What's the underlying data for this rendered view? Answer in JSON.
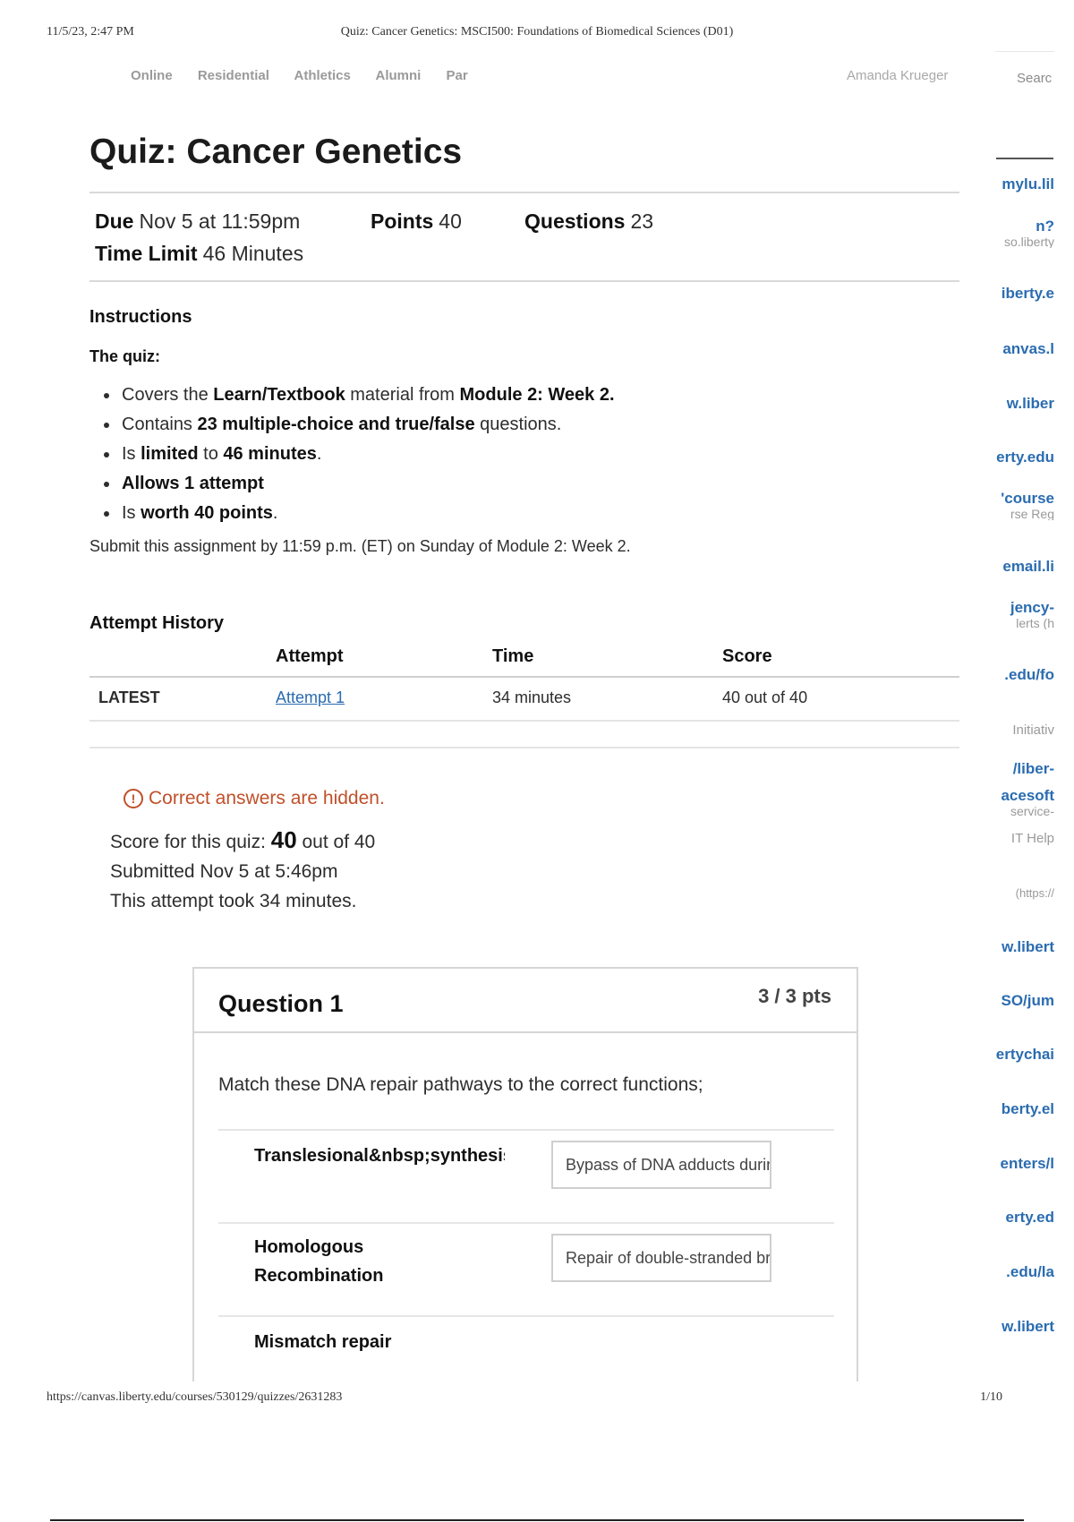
{
  "print_header": {
    "timestamp": "11/5/23, 2:47 PM",
    "doc_title": "Quiz: Cancer Genetics: MSCI500: Foundations of Biomedical Sciences (D01)"
  },
  "topnav": {
    "items": [
      "Online",
      "Residential",
      "Athletics",
      "Alumni",
      "Par"
    ],
    "user": "Amanda Krueger",
    "search": "Searc"
  },
  "sidebar": {
    "links": [
      {
        "text": "mylu.lil"
      },
      {
        "text": "n?",
        "sub": "so.liberty"
      },
      {
        "text": "iberty.e"
      },
      {
        "text": "anvas.l"
      },
      {
        "text": "w.liber"
      },
      {
        "text": "erty.edu"
      },
      {
        "text": "'course",
        "sub": "rse Reg"
      },
      {
        "text": "email.li"
      },
      {
        "text": "jency-",
        "sub": "lerts (h"
      },
      {
        "text": ".edu/fo"
      },
      {
        "text": "Initiativ"
      },
      {
        "text": "/liber-"
      },
      {
        "text": "acesoft",
        "sub": "service-"
      },
      {
        "text": "IT Help"
      },
      {
        "text": "(https://"
      },
      {
        "text": "w.libert"
      },
      {
        "text": "SO/jum"
      },
      {
        "text": "ertychai"
      },
      {
        "text": "berty.el"
      },
      {
        "text": "enters/l"
      },
      {
        "text": "erty.ed"
      },
      {
        "text": ".edu/la"
      },
      {
        "text": "w.libert"
      }
    ]
  },
  "quiz": {
    "title": "Quiz: Cancer Genetics",
    "due_label": "Due",
    "due_value": "Nov 5 at 11:59pm",
    "points_label": "Points",
    "points_value": "40",
    "questions_label": "Questions",
    "questions_value": "23",
    "time_limit_label": "Time Limit",
    "time_limit_value": "46 Minutes"
  },
  "instructions": {
    "heading": "Instructions",
    "subheading": "The quiz:",
    "bullets": [
      {
        "pre": "Covers the ",
        "b1": "Learn/Textbook",
        "mid": " material from ",
        "b2": "Module 2: Week 2.",
        "post": ""
      },
      {
        "pre": "Contains ",
        "b1": "23 multiple-choice and true/false",
        "mid": " questions.",
        "b2": "",
        "post": ""
      },
      {
        "pre": "Is ",
        "b1": "limited",
        "mid": " to ",
        "b2": "46 minutes",
        "post": "."
      },
      {
        "pre": "",
        "b1": "Allows 1 attempt",
        "mid": "",
        "b2": "",
        "post": ""
      },
      {
        "pre": "Is ",
        "b1": "worth 40 points",
        "mid": ".",
        "b2": "",
        "post": ""
      }
    ],
    "submit_note": "Submit this assignment by 11:59 p.m. (ET) on Sunday of Module 2: Week 2."
  },
  "attempt_history": {
    "heading": "Attempt History",
    "columns": [
      "",
      "Attempt",
      "Time",
      "Score"
    ],
    "rows": [
      {
        "label": "LATEST",
        "attempt": "Attempt 1",
        "time": "34 minutes",
        "score": "40 out of 40"
      }
    ]
  },
  "result": {
    "alert": "Correct answers are hidden.",
    "score_prefix": "Score for this quiz: ",
    "score_value": "40",
    "score_suffix": " out of 40",
    "submitted": "Submitted Nov 5 at 5:46pm",
    "duration": "This attempt took 34 minutes."
  },
  "question": {
    "title": "Question 1",
    "points": "3 / 3 pts",
    "text": "Match these DNA repair pathways to the correct functions;",
    "matches": [
      {
        "label": "Translesional&nbsp;synthesis",
        "answer": "Bypass of DNA adducts during replication"
      },
      {
        "label": "Homologous Recombination",
        "answer": "Repair of double-stranded breaks"
      },
      {
        "label": "Mismatch repair",
        "answer": ""
      }
    ]
  },
  "print_footer": {
    "url": "https://canvas.liberty.edu/courses/530129/quizzes/2631283",
    "page": "1/10"
  }
}
